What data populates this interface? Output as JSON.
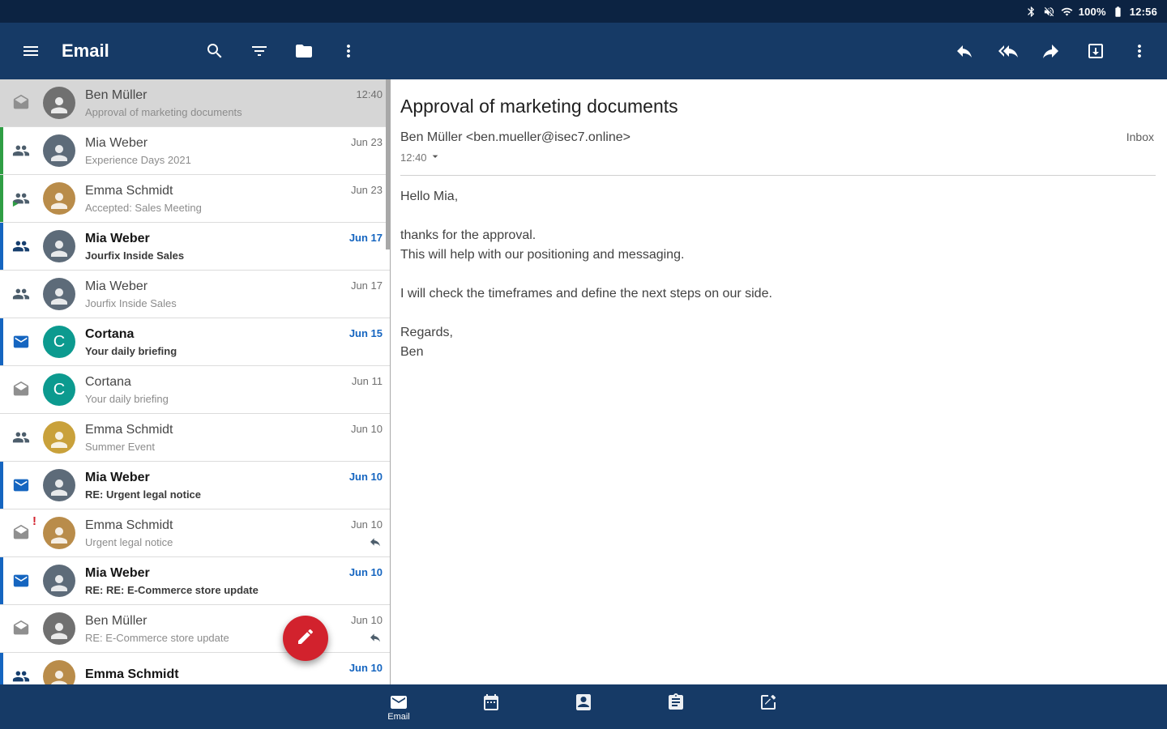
{
  "status_bar": {
    "icons": [
      "bluetooth-icon",
      "volume-off-icon",
      "wifi-icon",
      "battery-icon"
    ],
    "battery_pct": "100%",
    "time": "12:56"
  },
  "toolbar": {
    "title": "Email",
    "left_icons": [
      "menu-icon",
      "search-icon",
      "filter-icon",
      "folder-icon",
      "more-vert-icon"
    ],
    "right_icons": [
      "reply-icon",
      "reply-all-icon",
      "forward-icon",
      "move-to-folder-icon",
      "more-vert-icon"
    ]
  },
  "email_list": [
    {
      "sender": "Ben Müller",
      "subject": "Approval of marketing documents",
      "date": "12:40",
      "status_icon": "mail-open",
      "avatar": {
        "type": "photo",
        "color": "#707070"
      },
      "unread": false,
      "selected": true,
      "bar": null,
      "replied": false,
      "important": false
    },
    {
      "sender": "Mia Weber",
      "subject": "Experience Days 2021",
      "date": "Jun 23",
      "status_icon": "meeting",
      "avatar": {
        "type": "photo",
        "color": "#5d6b79"
      },
      "unread": false,
      "selected": false,
      "bar": "green",
      "replied": false,
      "important": false
    },
    {
      "sender": "Emma Schmidt",
      "subject": "Accepted: Sales Meeting",
      "date": "Jun 23",
      "status_icon": "meeting-accept",
      "avatar": {
        "type": "photo",
        "color": "#b98c4a"
      },
      "unread": false,
      "selected": false,
      "bar": "green",
      "replied": false,
      "important": false
    },
    {
      "sender": "Mia Weber",
      "subject": "Jourfix Inside Sales",
      "date": "Jun 17",
      "status_icon": "meeting",
      "avatar": {
        "type": "photo",
        "color": "#5d6b79"
      },
      "unread": true,
      "selected": false,
      "bar": "blue",
      "replied": false,
      "important": false
    },
    {
      "sender": "Mia Weber",
      "subject": "Jourfix Inside Sales",
      "date": "Jun 17",
      "status_icon": "meeting",
      "avatar": {
        "type": "photo",
        "color": "#5d6b79"
      },
      "unread": false,
      "selected": false,
      "bar": null,
      "replied": false,
      "important": false
    },
    {
      "sender": "Cortana",
      "subject": "Your daily briefing",
      "date": "Jun 15",
      "status_icon": "mail-closed",
      "avatar": {
        "type": "letter",
        "letter": "C",
        "color": "#0c9a8f"
      },
      "unread": true,
      "selected": false,
      "bar": "blue",
      "replied": false,
      "important": false
    },
    {
      "sender": "Cortana",
      "subject": "Your daily briefing",
      "date": "Jun 11",
      "status_icon": "mail-open",
      "avatar": {
        "type": "letter",
        "letter": "C",
        "color": "#0c9a8f"
      },
      "unread": false,
      "selected": false,
      "bar": null,
      "replied": false,
      "important": false
    },
    {
      "sender": "Emma Schmidt",
      "subject": "Summer Event",
      "date": "Jun 10",
      "status_icon": "meeting",
      "avatar": {
        "type": "photo",
        "color": "#c9a13b"
      },
      "unread": false,
      "selected": false,
      "bar": null,
      "replied": false,
      "important": false
    },
    {
      "sender": "Mia Weber",
      "subject": "RE: Urgent legal notice",
      "date": "Jun 10",
      "status_icon": "mail-closed",
      "avatar": {
        "type": "photo",
        "color": "#5d6b79"
      },
      "unread": true,
      "selected": false,
      "bar": "blue",
      "replied": false,
      "important": false
    },
    {
      "sender": "Emma Schmidt",
      "subject": "Urgent legal notice",
      "date": "Jun 10",
      "status_icon": "mail-open",
      "avatar": {
        "type": "photo",
        "color": "#b98c4a"
      },
      "unread": false,
      "selected": false,
      "bar": null,
      "replied": true,
      "important": true
    },
    {
      "sender": "Mia Weber",
      "subject": "RE: RE: E-Commerce store update",
      "date": "Jun 10",
      "status_icon": "mail-closed",
      "avatar": {
        "type": "photo",
        "color": "#5d6b79"
      },
      "unread": true,
      "selected": false,
      "bar": "blue",
      "replied": false,
      "important": false
    },
    {
      "sender": "Ben Müller",
      "subject": "RE: E-Commerce store update",
      "date": "Jun 10",
      "status_icon": "mail-open",
      "avatar": {
        "type": "photo",
        "color": "#707070"
      },
      "unread": false,
      "selected": false,
      "bar": null,
      "replied": true,
      "important": false
    },
    {
      "sender": "Emma Schmidt",
      "subject": "",
      "date": "Jun 10",
      "status_icon": "meeting",
      "avatar": {
        "type": "photo",
        "color": "#b98c4a"
      },
      "unread": true,
      "selected": false,
      "bar": "blue",
      "replied": false,
      "important": false
    }
  ],
  "detail": {
    "subject": "Approval of marketing documents",
    "from": "Ben Müller <ben.mueller@isec7.online>",
    "time": "12:40",
    "folder_label": "Inbox",
    "body": "Hello Mia,\n\nthanks for the approval.\nThis will help with our positioning and messaging.\n\nI will check the timeframes and define the next steps on our side.\n\nRegards,\nBen"
  },
  "fab": {
    "icon": "compose-pencil-icon"
  },
  "bottom_nav": {
    "items": [
      {
        "name": "email",
        "label": "Email",
        "active": true
      },
      {
        "name": "calendar",
        "label": "",
        "active": false
      },
      {
        "name": "contacts",
        "label": "",
        "active": false
      },
      {
        "name": "tasks",
        "label": "",
        "active": false
      },
      {
        "name": "notes",
        "label": "",
        "active": false
      }
    ]
  },
  "colors": {
    "navy": "#163a66",
    "status_bar_navy": "#0c2342",
    "accent_blue": "#1565c0",
    "meeting_green": "#2f9e44",
    "fab_red": "#d2222d",
    "cortana_teal": "#0c9a8f",
    "important_red": "#d2222d"
  }
}
